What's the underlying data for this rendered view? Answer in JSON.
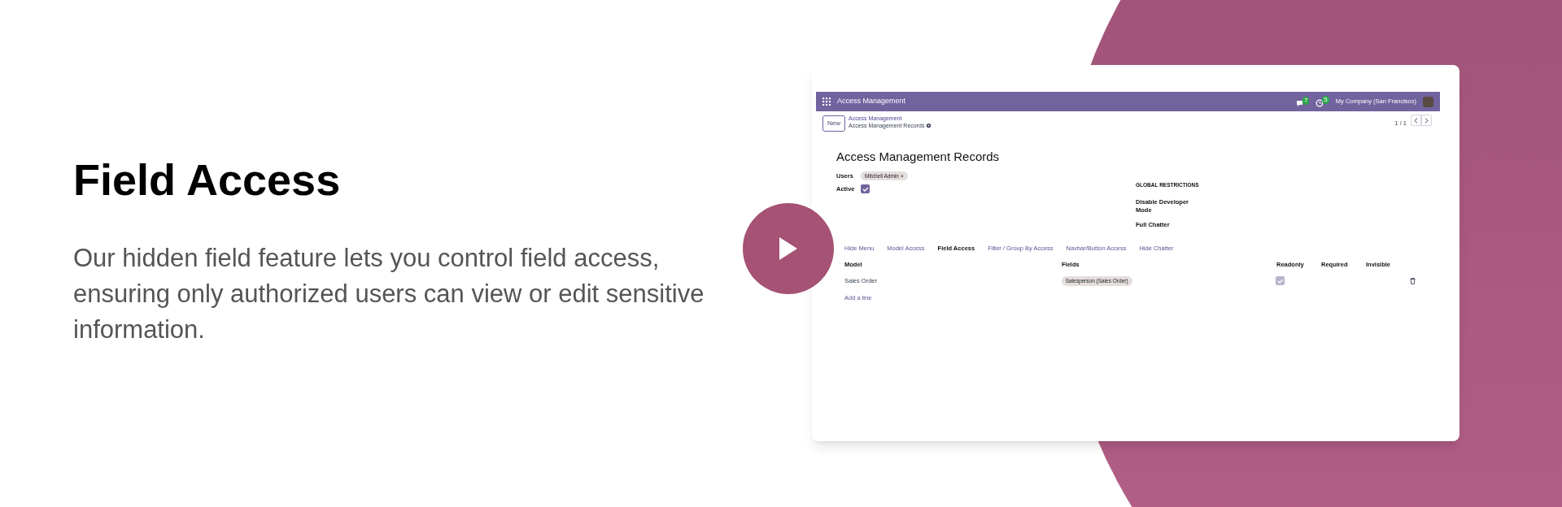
{
  "hero": {
    "title": "Field Access",
    "description": "Our hidden field feature lets you control field access, ensuring only authorized users can view or edit sensitive information."
  },
  "app": {
    "navbar": {
      "title": "Access Management",
      "messages_count": "7",
      "activities_count": "5",
      "company": "My Company (San Francisco)"
    },
    "control_panel": {
      "new_button": "New",
      "breadcrumb": "Access Management",
      "record_name": "Access Management Records",
      "pager": "1 / 1"
    },
    "form": {
      "title": "Access Management Records",
      "users_label": "Users",
      "users": [
        {
          "name": "Mitchell Admin",
          "remove": "×"
        }
      ],
      "active_label": "Active",
      "active": {
        "checked": true
      },
      "global_restrictions": "GLOBAL RESTRICTIONS",
      "restrictions": [
        "Disable Developer Mode",
        "Full Chatter"
      ]
    },
    "tabs": [
      {
        "label": "Hide Menu",
        "selected": false
      },
      {
        "label": "Model Access",
        "selected": false
      },
      {
        "label": "Field Access",
        "selected": true
      },
      {
        "label": "Filter / Group By Access",
        "selected": false
      },
      {
        "label": "Navbar/Button Access",
        "selected": false
      },
      {
        "label": "Hide Chatter",
        "selected": false
      }
    ],
    "table": {
      "columns": [
        "Model",
        "Fields",
        "Readonly",
        "Required",
        "Invisible"
      ],
      "rows": [
        {
          "model": "Sales Order",
          "fields": [
            "Salesperson (Sales Order)"
          ],
          "readonly": true
        }
      ],
      "add_line": "Add a line"
    }
  }
}
